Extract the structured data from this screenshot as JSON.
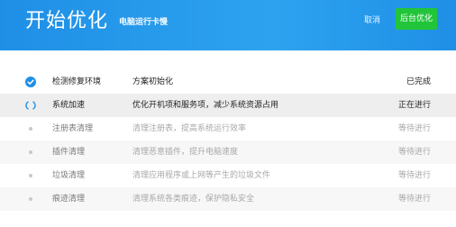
{
  "header": {
    "title": "开始优化",
    "subtitle": "电脑运行卡慢",
    "cancel_label": "取消",
    "background_label": "后台优化"
  },
  "colors": {
    "header_blue": "#1f8fe6",
    "button_green": "#22c53a",
    "check_blue": "#1f8fe6"
  },
  "tasks": [
    {
      "name": "检测修复环境",
      "desc": "方案初始化",
      "status": "已完成",
      "state": "done",
      "icon": "check-circle-icon"
    },
    {
      "name": "系统加速",
      "desc": "优化开机项和服务项，减少系统资源占用",
      "status": "正在进行",
      "state": "active",
      "icon": "spinner-icon"
    },
    {
      "name": "注册表清理",
      "desc": "清理注册表，提高系统运行效率",
      "status": "等待进行",
      "state": "wait",
      "icon": "dot-icon"
    },
    {
      "name": "插件清理",
      "desc": "清理恶意插件，提升电脑速度",
      "status": "等待进行",
      "state": "wait",
      "icon": "dot-icon"
    },
    {
      "name": "垃圾清理",
      "desc": "清理应用程序或上网等产生的垃圾文件",
      "status": "等待进行",
      "state": "wait",
      "icon": "dot-icon"
    },
    {
      "name": "痕迹清理",
      "desc": "清理系统各类痕迹，保护隐私安全",
      "status": "等待进行",
      "state": "wait",
      "icon": "dot-icon"
    }
  ]
}
